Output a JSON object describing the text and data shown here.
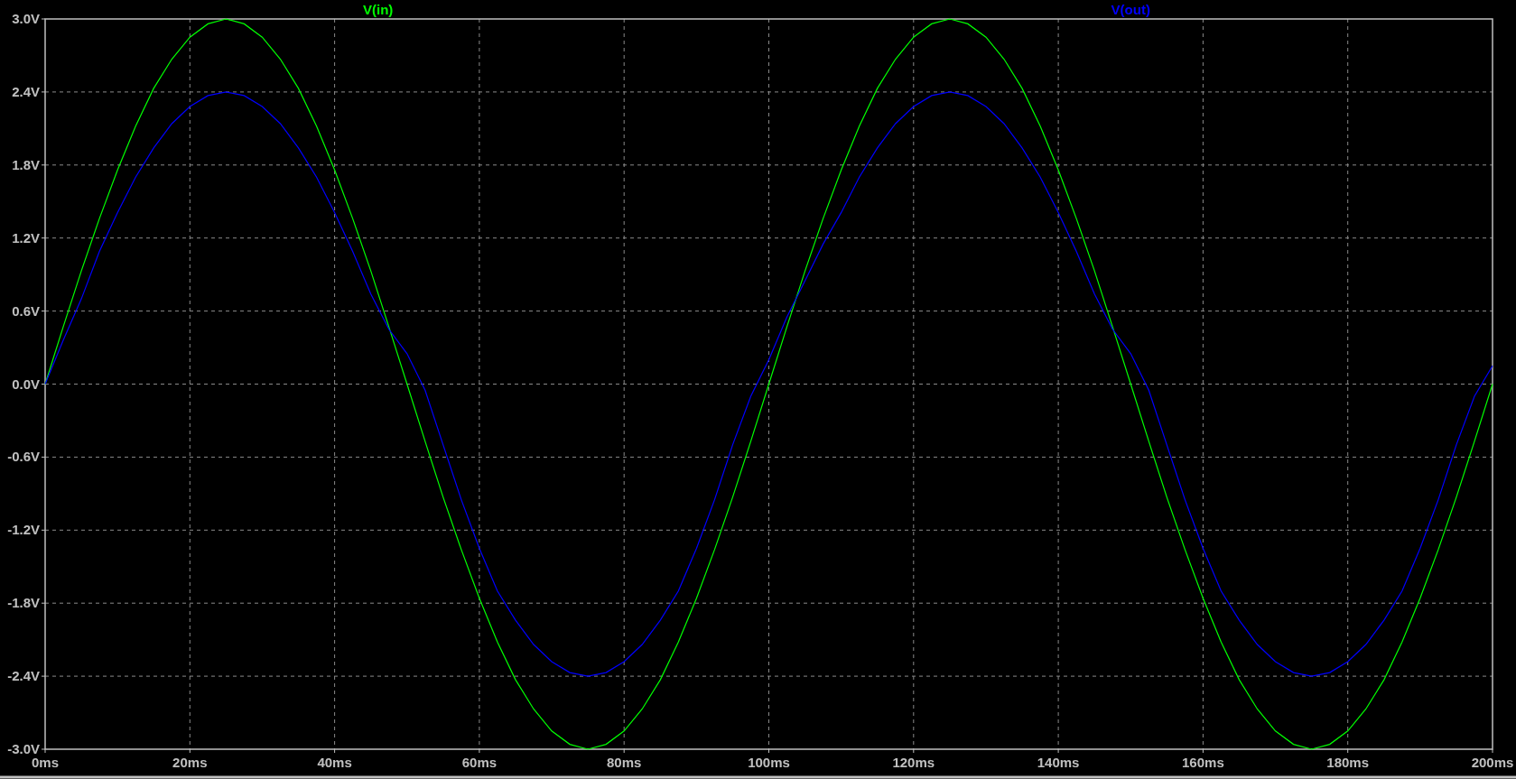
{
  "plot": {
    "chart_data": {
      "type": "line",
      "x": [
        0,
        2.5,
        5,
        7.5,
        10,
        12.5,
        15,
        17.5,
        20,
        22.5,
        25,
        27.5,
        30,
        32.5,
        35,
        37.5,
        40,
        42.5,
        45,
        47.5,
        50,
        52.5,
        55,
        57.5,
        60,
        62.5,
        65,
        67.5,
        70,
        72.5,
        75,
        77.5,
        80,
        82.5,
        85,
        87.5,
        90,
        92.5,
        95,
        97.5,
        100,
        102.5,
        105,
        107.5,
        110,
        112.5,
        115,
        117.5,
        120,
        122.5,
        125,
        127.5,
        130,
        132.5,
        135,
        137.5,
        140,
        142.5,
        145,
        147.5,
        150,
        152.5,
        155,
        157.5,
        160,
        162.5,
        165,
        167.5,
        170,
        172.5,
        175,
        177.5,
        180,
        182.5,
        185,
        187.5,
        190,
        192.5,
        195,
        197.5,
        200
      ],
      "series": [
        {
          "name": "V(in)",
          "color": "#00ff00",
          "values": [
            0,
            0.47,
            0.93,
            1.36,
            1.76,
            2.12,
            2.43,
            2.67,
            2.85,
            2.96,
            3.0,
            2.96,
            2.85,
            2.67,
            2.43,
            2.12,
            1.76,
            1.36,
            0.93,
            0.47,
            0,
            -0.47,
            -0.93,
            -1.36,
            -1.76,
            -2.12,
            -2.43,
            -2.67,
            -2.85,
            -2.96,
            -3.0,
            -2.96,
            -2.85,
            -2.67,
            -2.43,
            -2.12,
            -1.76,
            -1.36,
            -0.93,
            -0.47,
            0,
            0.47,
            0.93,
            1.36,
            1.76,
            2.12,
            2.43,
            2.67,
            2.85,
            2.96,
            3.0,
            2.96,
            2.85,
            2.67,
            2.43,
            2.12,
            1.76,
            1.36,
            0.93,
            0.47,
            0,
            -0.47,
            -0.93,
            -1.36,
            -1.76,
            -2.12,
            -2.43,
            -2.67,
            -2.85,
            -2.96,
            -3.0,
            -2.96,
            -2.85,
            -2.67,
            -2.43,
            -2.12,
            -1.76,
            -1.36,
            -0.93,
            -0.47,
            0
          ]
        },
        {
          "name": "V(out)",
          "color": "#0000ff",
          "values": [
            0,
            0.36,
            0.7,
            1.09,
            1.41,
            1.7,
            1.94,
            2.14,
            2.28,
            2.37,
            2.4,
            2.37,
            2.28,
            2.14,
            1.94,
            1.7,
            1.41,
            1.09,
            0.74,
            0.45,
            0.25,
            -0.05,
            -0.5,
            -0.95,
            -1.35,
            -1.7,
            -1.94,
            -2.14,
            -2.28,
            -2.37,
            -2.4,
            -2.37,
            -2.28,
            -2.14,
            -1.94,
            -1.7,
            -1.35,
            -0.95,
            -0.5,
            -0.1,
            0.2,
            0.55,
            0.85,
            1.15,
            1.41,
            1.7,
            1.94,
            2.14,
            2.28,
            2.37,
            2.4,
            2.37,
            2.28,
            2.14,
            1.94,
            1.7,
            1.41,
            1.09,
            0.74,
            0.45,
            0.25,
            -0.05,
            -0.5,
            -0.95,
            -1.35,
            -1.7,
            -1.94,
            -2.14,
            -2.28,
            -2.37,
            -2.4,
            -2.37,
            -2.28,
            -2.14,
            -1.94,
            -1.7,
            -1.35,
            -0.95,
            -0.5,
            -0.1,
            0.15
          ]
        }
      ],
      "grid": true,
      "xlim": [
        0,
        200
      ],
      "ylim": [
        -3,
        3
      ],
      "xticks": [
        {
          "value": 0,
          "label": "0ms"
        },
        {
          "value": 20,
          "label": "20ms"
        },
        {
          "value": 40,
          "label": "40ms"
        },
        {
          "value": 60,
          "label": "60ms"
        },
        {
          "value": 80,
          "label": "80ms"
        },
        {
          "value": 100,
          "label": "100ms"
        },
        {
          "value": 120,
          "label": "120ms"
        },
        {
          "value": 140,
          "label": "140ms"
        },
        {
          "value": 160,
          "label": "160ms"
        },
        {
          "value": 180,
          "label": "180ms"
        },
        {
          "value": 200,
          "label": "200ms"
        }
      ],
      "yticks": [
        {
          "value": -3,
          "label": "-3.0V"
        },
        {
          "value": -2.4,
          "label": "-2.4V"
        },
        {
          "value": -1.8,
          "label": "-1.8V"
        },
        {
          "value": -1.2,
          "label": "-1.2V"
        },
        {
          "value": -0.6,
          "label": "-0.6V"
        },
        {
          "value": 0,
          "label": "0.0V"
        },
        {
          "value": 0.6,
          "label": "0.6V"
        },
        {
          "value": 1.2,
          "label": "1.2V"
        },
        {
          "value": 1.8,
          "label": "1.8V"
        },
        {
          "value": 2.4,
          "label": "2.4V"
        },
        {
          "value": 3,
          "label": "3.0V"
        }
      ]
    }
  }
}
